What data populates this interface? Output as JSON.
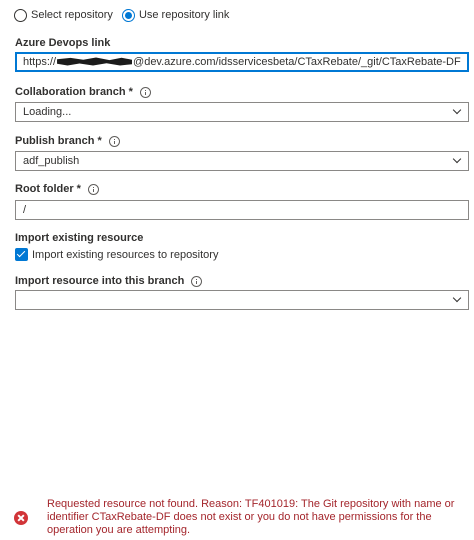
{
  "repo_mode": {
    "options": [
      {
        "label": "Select repository",
        "checked": false
      },
      {
        "label": "Use repository link",
        "checked": true
      }
    ]
  },
  "azure_devops_link": {
    "label": "Azure Devops link",
    "value_prefix": "https://",
    "value_suffix": "@dev.azure.com/idsservicesbeta/CTaxRebate/_git/CTaxRebate-DF"
  },
  "collaboration_branch": {
    "label": "Collaboration branch",
    "required_mark": "*",
    "value": "Loading..."
  },
  "publish_branch": {
    "label": "Publish branch",
    "required_mark": "*",
    "value": "adf_publish"
  },
  "root_folder": {
    "label": "Root folder",
    "required_mark": "*",
    "value": "/"
  },
  "import_existing": {
    "heading": "Import existing resource",
    "checkbox_label": "Import existing resources to repository",
    "checked": true
  },
  "import_branch": {
    "label": "Import resource into this branch",
    "value": ""
  },
  "error": {
    "message": "Requested resource not found. Reason: TF401019: The Git repository with name or identifier CTaxRebate-DF does not exist or you do not have permissions for the operation you are attempting."
  },
  "colors": {
    "accent": "#0078d4",
    "error": "#a4262c",
    "error_icon": "#d13438"
  }
}
